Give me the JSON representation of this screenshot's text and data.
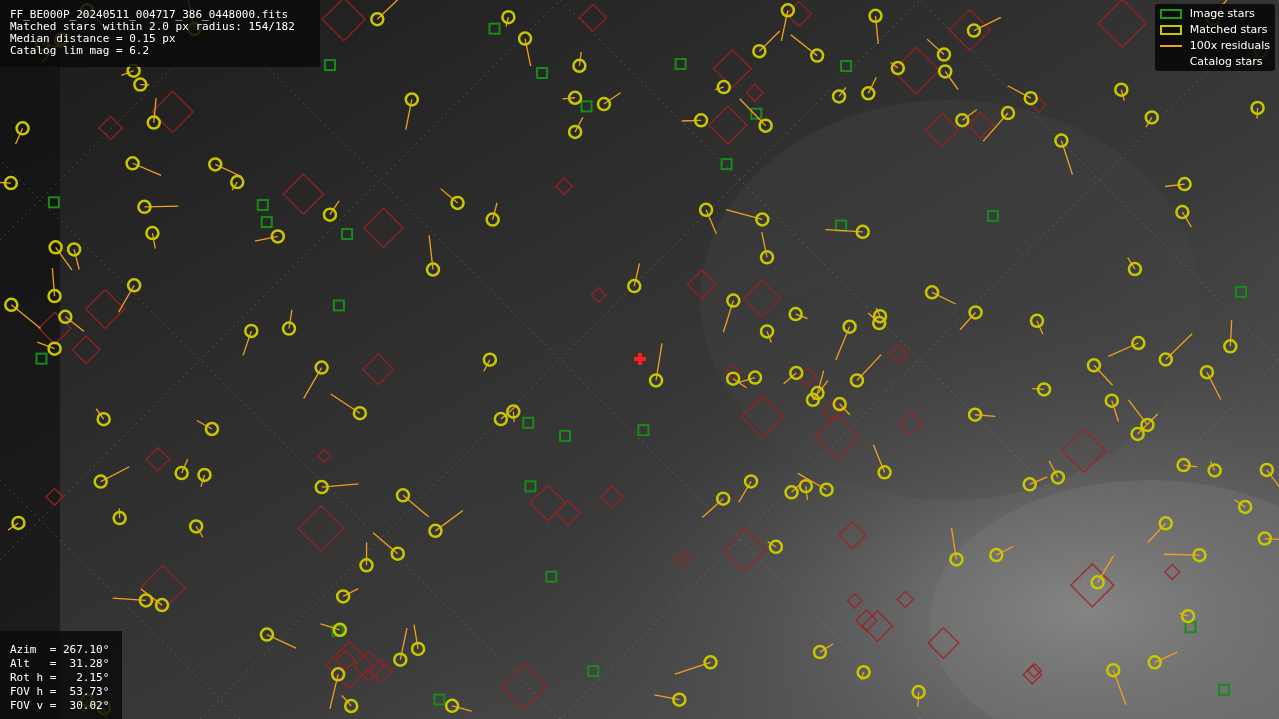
{
  "info": {
    "lines": [
      "FF_BE000P_20240511_004717_386_0448000.fits",
      "Matched stars within 2.0 px radius: 154/182",
      "Median distance = 0.15 px",
      "Catalog lim mag = 6.2"
    ]
  },
  "legend": {
    "items": [
      {
        "label": "Image stars"
      },
      {
        "label": "Matched stars",
        "kind": "matched"
      },
      {
        "label": "100x residuals",
        "kind": "residual"
      },
      {
        "label": "Catalog stars",
        "kind": "catalog"
      }
    ]
  },
  "pointing": {
    "lines": [
      "Azim  = 267.10°",
      "Alt   =  31.28°",
      "Rot h =   2.15°",
      "FOV h =  53.73°",
      "FOV v =  30.02°"
    ]
  }
}
